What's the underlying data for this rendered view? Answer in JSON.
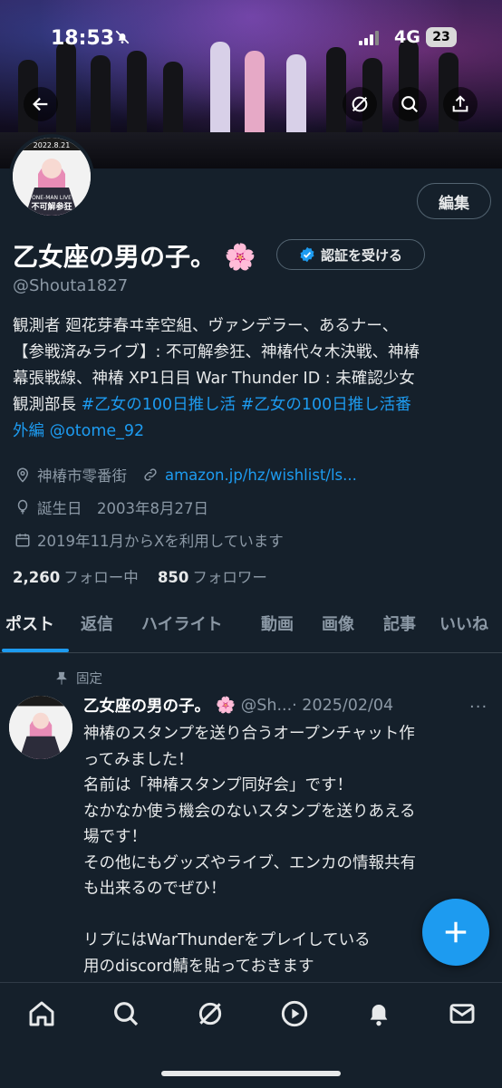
{
  "status_bar": {
    "time": "18:53",
    "network": "4G",
    "battery": "23"
  },
  "profile": {
    "display_name": "乙女座の男の子。",
    "name_emoji": "🌸",
    "handle": "@Shouta1827",
    "edit_label": "編集",
    "verify_label": "認証を受ける",
    "bio_lines": [
      [
        {
          "t": "観測者 廻花芽春ヰ幸空組、ヴァンデラー、あるナー、",
          "link": false
        }
      ],
      [
        {
          "t": "【参戦済みライブ】: 不可解参狂、神椿代々木決戦、神椿",
          "link": false
        }
      ],
      [
        {
          "t": "幕張戦線、神椿 XP1日目 War Thunder ID : 未確認少女",
          "link": false
        }
      ],
      [
        {
          "t": "観測部長 ",
          "link": false
        },
        {
          "t": "#乙女の100日推し活",
          "link": true
        },
        {
          "t": " ",
          "link": false
        },
        {
          "t": "#乙女の100日推し活番",
          "link": true
        }
      ],
      [
        {
          "t": "外編",
          "link": true
        },
        {
          "t": " ",
          "link": false
        },
        {
          "t": "@otome_92",
          "link": true
        }
      ]
    ],
    "location": "神椿市零番街",
    "website": "amazon.jp/hz/wishlist/ls...",
    "birthday": "誕生日　2003年8月27日",
    "joined": "2019年11月からXを利用しています",
    "following_count": "2,260",
    "following_label": "フォロー中",
    "followers_count": "850",
    "followers_label": "フォロワー"
  },
  "tabs": [
    "ポスト",
    "返信",
    "ハイライト",
    "動画",
    "画像",
    "記事",
    "いいね"
  ],
  "post": {
    "pinned_label": "固定",
    "author": "乙女座の男の子。",
    "author_emoji": "🌸",
    "handle_date": "@Sh...· 2025/02/04",
    "more": "···",
    "lines": [
      "神椿のスタンプを送り合うオープンチャット作",
      "ってみました！",
      "名前は「神椿スタンプ同好会」です！",
      "なかなか使う機会のないスタンプを送りあえる",
      "場です！",
      "その他にもグッズやライブ、エンカの情報共有",
      "も出来るのでぜひ！",
      "",
      "リプにはWarThunderをプレイしている",
      "用のdiscord鯖を貼っておきます"
    ]
  },
  "avatar_text": {
    "date": "2022.8.21",
    "live": "ONE-MAN LIVE",
    "title": "不可解参狂"
  },
  "colors": {
    "background": "#15202b",
    "accent": "#1d9bf0",
    "muted": "#8b98a5",
    "text": "#e7e9ea"
  }
}
